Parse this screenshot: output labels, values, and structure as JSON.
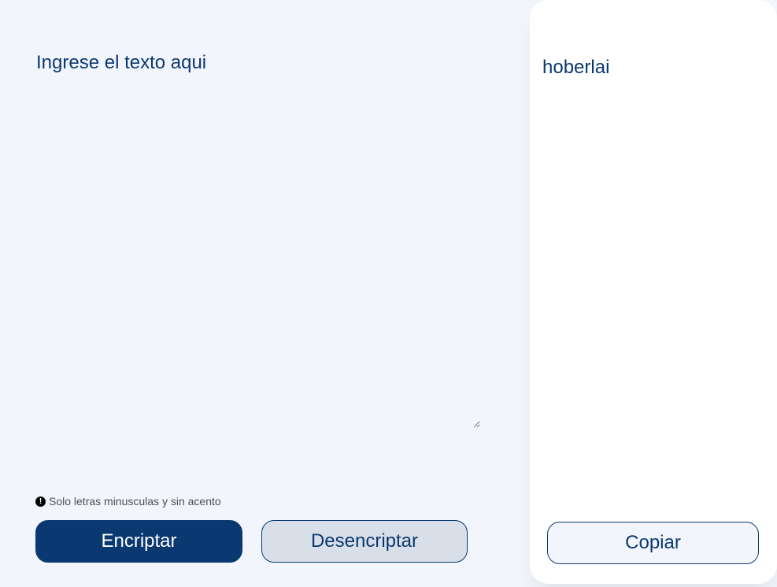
{
  "input": {
    "placeholder": "Ingrese el texto aqui",
    "value": ""
  },
  "hint": {
    "icon": "exclamation-circle-icon",
    "text": "Solo letras minusculas y sin acento"
  },
  "buttons": {
    "encrypt_label": "Encriptar",
    "decrypt_label": "Desencriptar",
    "copy_label": "Copiar"
  },
  "output": {
    "text": "hoberlai"
  },
  "colors": {
    "background": "#f3f5fc",
    "primary": "#0a3871",
    "secondary_button_bg": "#d8dfe8",
    "panel": "#ffffff",
    "hint_text": "#495057"
  }
}
